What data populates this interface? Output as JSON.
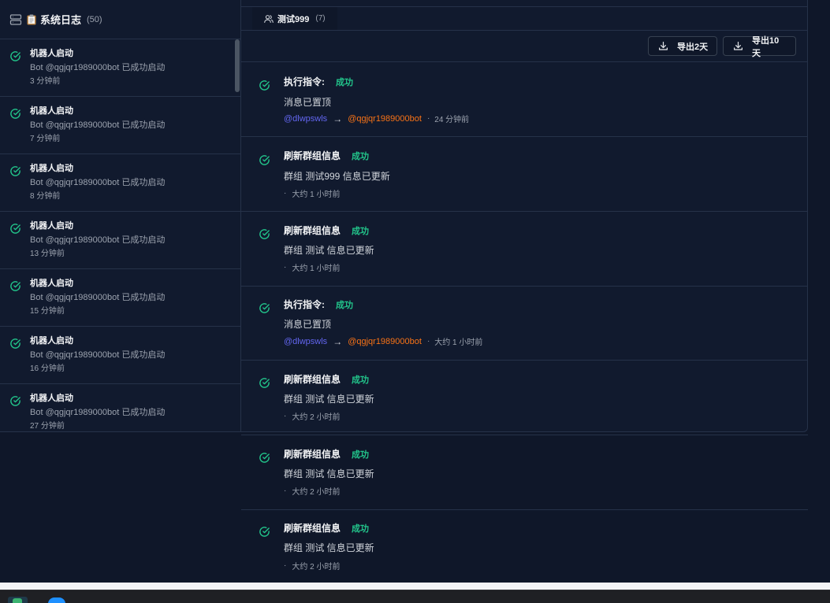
{
  "left_panel": {
    "title": "系统日志",
    "count": "(50)",
    "icons": {
      "header": "server-icon",
      "title_prefix": "clipboard-icon",
      "item": "check-circle-icon"
    },
    "items": [
      {
        "title": "机器人启动",
        "desc": "Bot @qgjqr1989000bot 已成功启动",
        "time": "3 分钟前"
      },
      {
        "title": "机器人启动",
        "desc": "Bot @qgjqr1989000bot 已成功启动",
        "time": "7 分钟前"
      },
      {
        "title": "机器人启动",
        "desc": "Bot @qgjqr1989000bot 已成功启动",
        "time": "8 分钟前"
      },
      {
        "title": "机器人启动",
        "desc": "Bot @qgjqr1989000bot 已成功启动",
        "time": "13 分钟前"
      },
      {
        "title": "机器人启动",
        "desc": "Bot @qgjqr1989000bot 已成功启动",
        "time": "15 分钟前"
      },
      {
        "title": "机器人启动",
        "desc": "Bot @qgjqr1989000bot 已成功启动",
        "time": "16 分钟前"
      },
      {
        "title": "机器人启动",
        "desc": "Bot @qgjqr1989000bot 已成功启动",
        "time": "27 分钟前"
      }
    ]
  },
  "tab": {
    "label": "测试999",
    "count": "(7)",
    "icon": "users-icon"
  },
  "toolbar": {
    "export_2_label": "导出2天",
    "export_10_label": "导出10天",
    "icon": "download-icon"
  },
  "activities": [
    {
      "action": "执行指令:",
      "status": "成功",
      "message": "消息已置顶",
      "from": "@dlwpswls",
      "arrow": "→",
      "to": "@qgjqr1989000bot",
      "dot": "·",
      "time": "24 分钟前"
    },
    {
      "action": "刷新群组信息",
      "status": "成功",
      "message": "群组 测试999 信息已更新",
      "dot": "·",
      "time": "大约 1 小时前"
    },
    {
      "action": "刷新群组信息",
      "status": "成功",
      "message": "群组 测试 信息已更新",
      "dot": "·",
      "time": "大约 1 小时前"
    },
    {
      "action": "执行指令:",
      "status": "成功",
      "message": "消息已置顶",
      "from": "@dlwpswls",
      "arrow": "→",
      "to": "@qgjqr1989000bot",
      "dot": "·",
      "time": "大约 1 小时前"
    },
    {
      "action": "刷新群组信息",
      "status": "成功",
      "message": "群组 测试 信息已更新",
      "dot": "·",
      "time": "大约 2 小时前"
    },
    {
      "action": "刷新群组信息",
      "status": "成功",
      "message": "群组 测试 信息已更新",
      "dot": "·",
      "time": "大约 2 小时前"
    },
    {
      "action": "刷新群组信息",
      "status": "成功",
      "message": "群组 测试 信息已更新",
      "dot": "·",
      "time": "大约 2 小时前"
    }
  ],
  "colors": {
    "background": "#0f1729",
    "panel": "#111a2e",
    "success": "#22c58b",
    "from_user": "#6366f1",
    "to_user": "#f97316"
  }
}
